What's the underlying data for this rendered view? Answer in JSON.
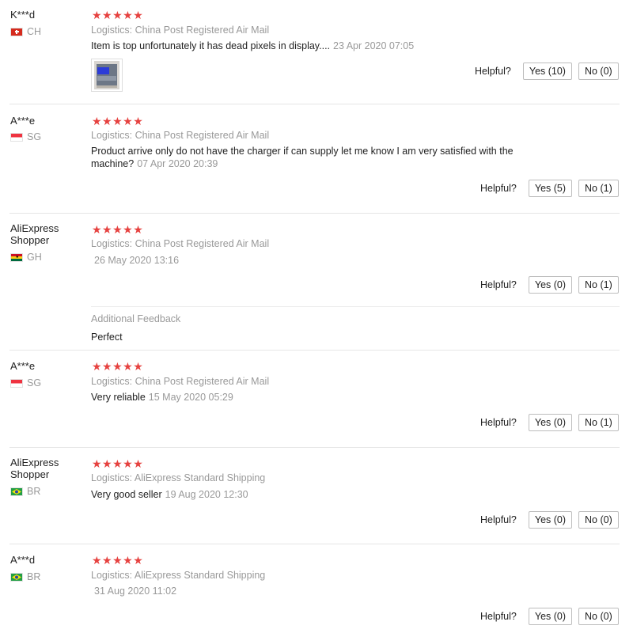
{
  "reviews": [
    {
      "user": "K***d",
      "country": "CH",
      "flag": "ch",
      "stars": "★★★★★",
      "logistics": "Logistics: China Post Registered Air Mail",
      "text": "Item is top unfortunately it has dead pixels in display....",
      "date": "23 Apr 2020 07:05",
      "helpful_label": "Helpful?",
      "yes": "Yes (10)",
      "no": "No (0)"
    },
    {
      "user": "A***e",
      "country": "SG",
      "flag": "sg",
      "stars": "★★★★★",
      "logistics": "Logistics: China Post Registered Air Mail",
      "text_line1": "Product arrive only do not have the charger if can supply let me know I am very satisfied with the",
      "text_line2": "machine?",
      "date": "07 Apr 2020 20:39",
      "helpful_label": "Helpful?",
      "yes": "Yes (5)",
      "no": "No (1)"
    },
    {
      "user_line1": "AliExpress",
      "user_line2": "Shopper",
      "country": "GH",
      "flag": "gh",
      "stars": "★★★★★",
      "logistics": "Logistics: China Post Registered Air Mail",
      "date": "26 May 2020 13:16",
      "helpful_label": "Helpful?",
      "yes": "Yes (0)",
      "no": "No (1)",
      "additional_title": "Additional Feedback",
      "additional_text": "Perfect"
    },
    {
      "user": "A***e",
      "country": "SG",
      "flag": "sg",
      "stars": "★★★★★",
      "logistics": "Logistics: China Post Registered Air Mail",
      "text": "Very reliable",
      "date": "15 May 2020 05:29",
      "helpful_label": "Helpful?",
      "yes": "Yes (0)",
      "no": "No (1)"
    },
    {
      "user_line1": "AliExpress",
      "user_line2": "Shopper",
      "country": "BR",
      "flag": "br",
      "stars": "★★★★★",
      "logistics": "Logistics: AliExpress Standard Shipping",
      "text": "Very good seller",
      "date": "19 Aug 2020 12:30",
      "helpful_label": "Helpful?",
      "yes": "Yes (0)",
      "no": "No (0)"
    },
    {
      "user": "A***d",
      "country": "BR",
      "flag": "br",
      "stars": "★★★★★",
      "logistics": "Logistics: AliExpress Standard Shipping",
      "date": "31 Aug 2020 11:02",
      "helpful_label": "Helpful?",
      "yes": "Yes (0)",
      "no": "No (0)"
    }
  ],
  "colors": {
    "star": "#e6413f",
    "muted": "#999999",
    "text": "#222222",
    "divider": "#e6e6e6"
  }
}
